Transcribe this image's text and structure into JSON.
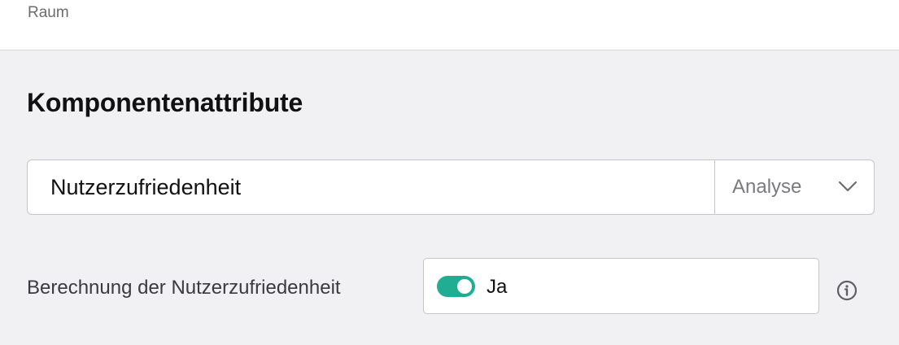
{
  "header": {
    "label": "Raum"
  },
  "section": {
    "title": "Komponentenattribute"
  },
  "attribute_field": {
    "name_value": "Nutzerzufriedenheit",
    "type_selected": "Analyse",
    "type_icon": "chevron-down-icon"
  },
  "calculation_row": {
    "label": "Berechnung der Nutzerzufriedenheit",
    "toggle_state": "on",
    "toggle_label": "Ja",
    "toggle_color": "#1fae93",
    "info_icon": "info-icon"
  }
}
